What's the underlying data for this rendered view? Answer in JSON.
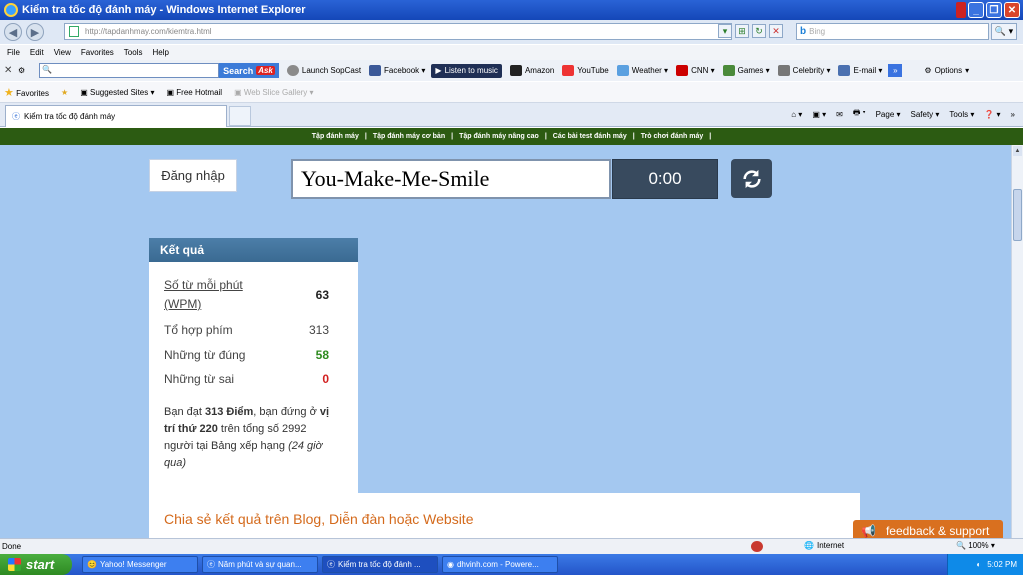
{
  "window": {
    "title": "Kiểm tra tốc độ đánh máy - Windows Internet Explorer"
  },
  "address": {
    "url": "http://tapdanhmay.com/kiemtra.html",
    "search_placeholder": "Bing",
    "search_engine_icon": "b"
  },
  "menu": [
    "File",
    "Edit",
    "View",
    "Favorites",
    "Tools",
    "Help"
  ],
  "ask_toolbar": {
    "search_label": "Search",
    "ask_logo": "Ask",
    "items": [
      "Launch SopCast",
      "Facebook ▾",
      "Amazon",
      "YouTube",
      "Weather ▾",
      "CNN ▾",
      "Games ▾",
      "Celebrity ▾",
      "E-mail ▾"
    ],
    "listen_label": "Listen to music",
    "options_label": "Options"
  },
  "favorites_bar": {
    "favorites_label": "Favorites",
    "suggested_sites": "Suggested Sites ▾",
    "free_hotmail": "Free Hotmail",
    "web_slice": "Web Slice Gallery ▾"
  },
  "tab": {
    "title": "Kiểm tra tốc độ đánh máy"
  },
  "command_bar": [
    "Page ▾",
    "Safety ▾",
    "Tools ▾"
  ],
  "site_nav": [
    "Tập đánh máy",
    "Tập đánh máy cơ bản",
    "Tập đánh máy nâng cao",
    "Các bài test đánh máy",
    "Trò chơi đánh máy"
  ],
  "typing": {
    "login_label": "Đăng nhập",
    "current_word": "You-Make-Me-Smile",
    "timer": "0:00"
  },
  "results": {
    "title": "Kết quả",
    "wpm_label": "Số từ mỗi phút (WPM)",
    "wpm_value": "63",
    "keystrokes_label": "Tổ hợp phím",
    "keystrokes_value": "313",
    "correct_label": "Những từ đúng",
    "correct_value": "58",
    "wrong_label": "Những từ sai",
    "wrong_value": "0",
    "summary_p1": "Bạn đạt ",
    "summary_points": "313 Điểm",
    "summary_p2": ", bạn đứng ở ",
    "summary_rank": "vị trí thứ 220",
    "summary_p3": " trên tổng số 2992 người tại Bảng xếp hạng ",
    "summary_p4": "(24 giờ qua)",
    "correct_color": "#2e8b1f",
    "wrong_color": "#d22020"
  },
  "share": {
    "title": "Chia sẻ kết quả trên Blog, Diễn đàn hoặc Website"
  },
  "feedback": {
    "label": "feedback & support"
  },
  "status": {
    "text": "Done",
    "zone": "Internet",
    "zoom": "100% ▾"
  },
  "taskbar": {
    "start": "start",
    "tasks": [
      "Yahoo! Messenger",
      "Năm phút và sự quan...",
      "Kiểm tra tốc độ đánh ...",
      "dhvinh.com - Powere..."
    ],
    "clock": "5:02 PM"
  }
}
